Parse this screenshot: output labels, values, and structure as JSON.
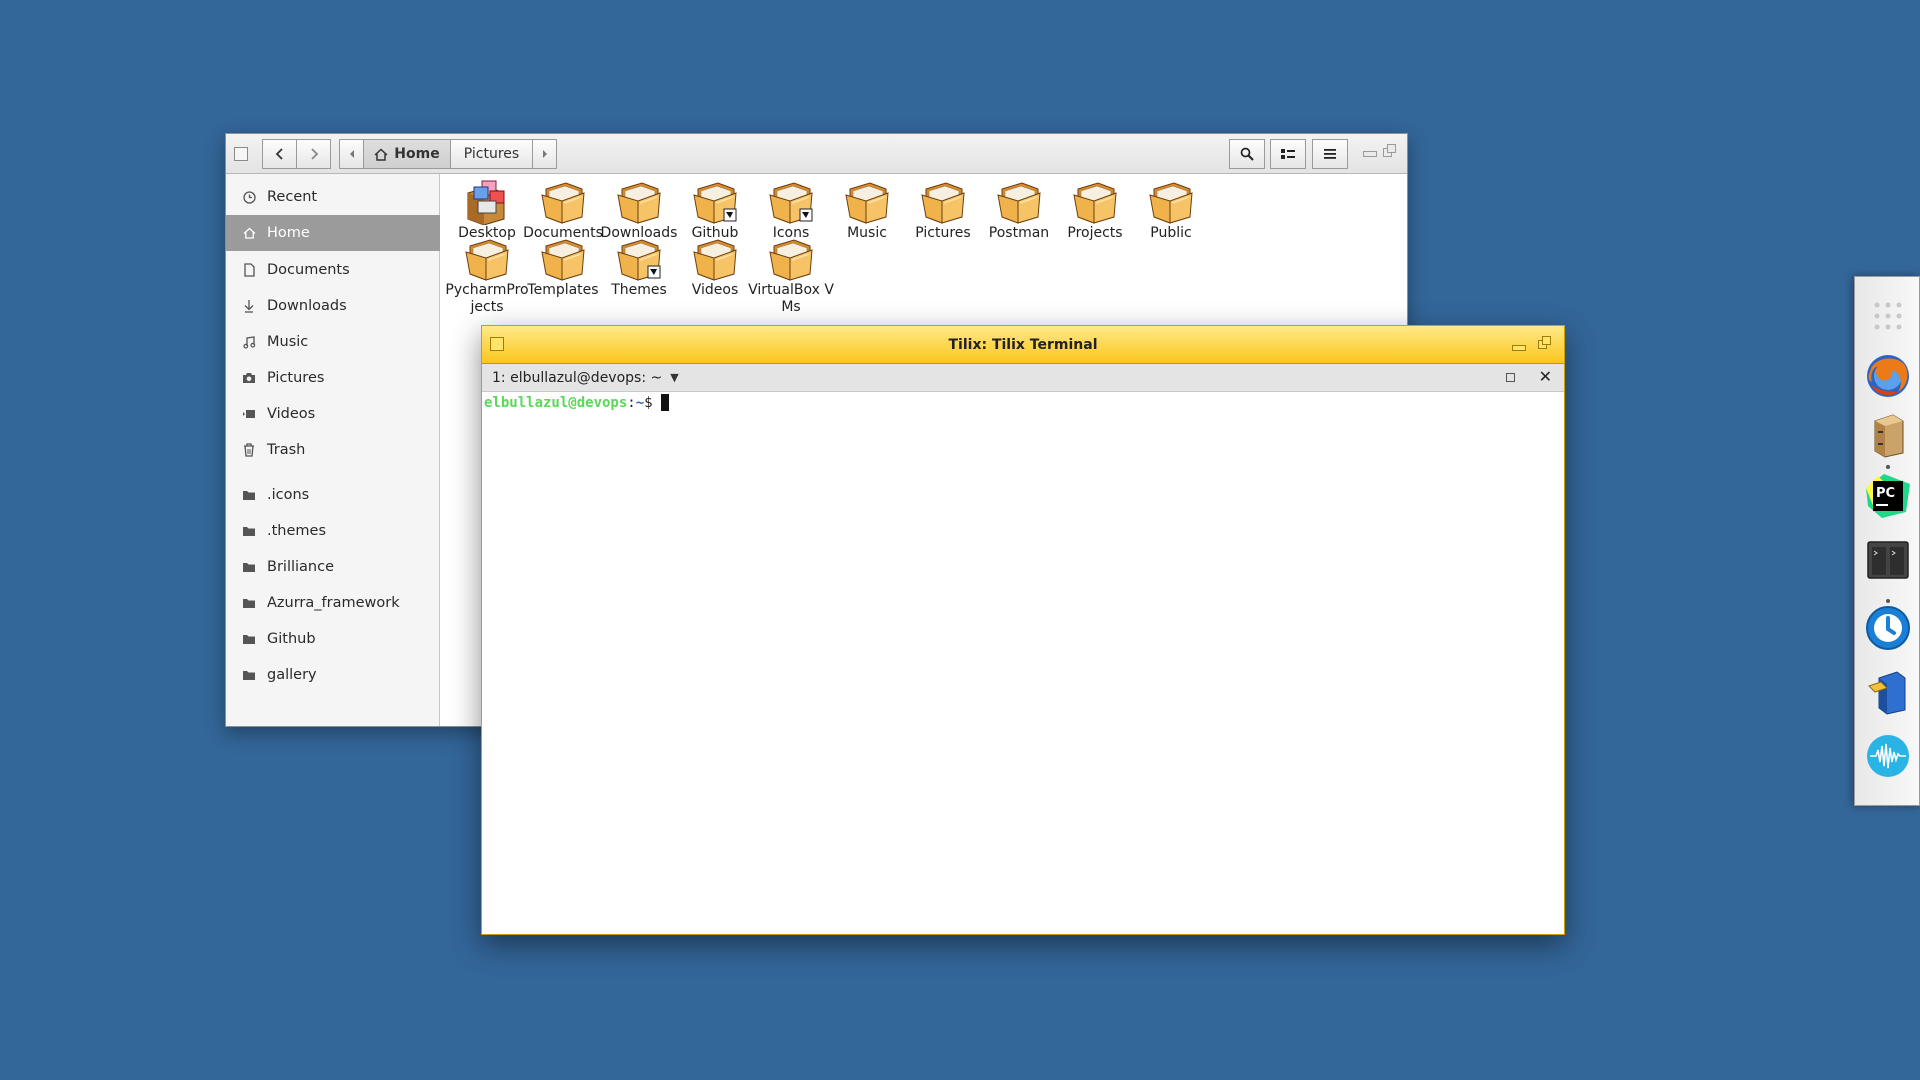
{
  "file_manager": {
    "breadcrumb": {
      "home_label": "Home",
      "current_label": "Pictures"
    },
    "sidebar": {
      "items": [
        {
          "label": "Recent",
          "icon": "clock-icon"
        },
        {
          "label": "Home",
          "icon": "home-icon",
          "active": true
        },
        {
          "label": "Documents",
          "icon": "document-icon"
        },
        {
          "label": "Downloads",
          "icon": "download-icon"
        },
        {
          "label": "Music",
          "icon": "music-icon"
        },
        {
          "label": "Pictures",
          "icon": "camera-icon"
        },
        {
          "label": "Videos",
          "icon": "video-icon"
        },
        {
          "label": "Trash",
          "icon": "trash-icon"
        },
        {
          "label": ".icons",
          "icon": "folder-icon"
        },
        {
          "label": ".themes",
          "icon": "folder-icon"
        },
        {
          "label": "Brilliance",
          "icon": "folder-icon"
        },
        {
          "label": "Azurra_framework",
          "icon": "folder-icon"
        },
        {
          "label": "Github",
          "icon": "folder-icon"
        },
        {
          "label": "gallery",
          "icon": "folder-icon"
        }
      ]
    },
    "folders": [
      {
        "label": "Desktop",
        "icon": "desktop-icon"
      },
      {
        "label": "Documents",
        "icon": "folder-icon"
      },
      {
        "label": "Downloads",
        "icon": "folder-icon"
      },
      {
        "label": "Github",
        "icon": "folder-link-icon"
      },
      {
        "label": "Icons",
        "icon": "folder-link-icon"
      },
      {
        "label": "Music",
        "icon": "folder-icon"
      },
      {
        "label": "Pictures",
        "icon": "folder-icon"
      },
      {
        "label": "Postman",
        "icon": "folder-icon"
      },
      {
        "label": "Projects",
        "icon": "folder-icon"
      },
      {
        "label": "Public",
        "icon": "folder-icon"
      },
      {
        "label": "PycharmProjects",
        "icon": "folder-icon"
      },
      {
        "label": "Templates",
        "icon": "folder-icon"
      },
      {
        "label": "Themes",
        "icon": "folder-link-icon"
      },
      {
        "label": "Videos",
        "icon": "folder-icon"
      },
      {
        "label": "VirtualBox VMs",
        "icon": "folder-icon"
      }
    ]
  },
  "terminal": {
    "title": "Tilix: Tilix Terminal",
    "tab_label": "1: elbullazul@devops: ~",
    "prompt": {
      "user_host": "elbullazul@devops",
      "colon": ":",
      "path": "~",
      "dollar": "$"
    }
  },
  "dock": {
    "items": [
      "app-grid-icon",
      "firefox-icon",
      "file-cabinet-icon",
      "pycharm-icon",
      "tilix-terminal-icon",
      "timeshift-icon",
      "mailbox-icon",
      "audio-wave-icon"
    ]
  },
  "colors": {
    "desktop_bg": "#336699",
    "terminal_titlebar": "#fbc61a",
    "prompt_user": "#5bd75b",
    "prompt_path": "#3a63c8",
    "sidebar_active": "#9b9b9b"
  }
}
